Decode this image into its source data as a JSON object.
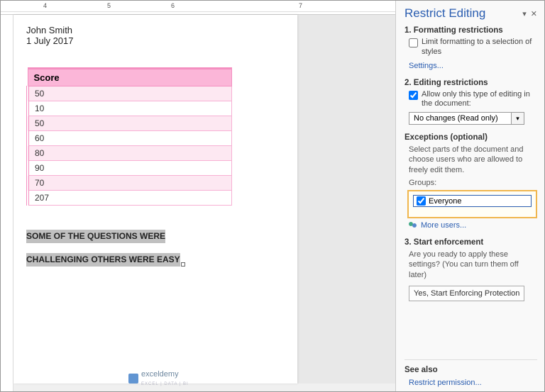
{
  "ruler": {
    "marks": [
      "4",
      "5",
      "6",
      "7"
    ]
  },
  "document": {
    "author": "John Smith",
    "date": "1 July 2017",
    "selected_line1": "SOME OF THE QUESTIONS WERE",
    "selected_line2": "CHALLENGING OTHERS WERE EASY"
  },
  "chart_data": {
    "type": "table",
    "title": "Score",
    "columns": [
      "Score"
    ],
    "values": [
      50,
      10,
      50,
      60,
      80,
      90,
      70,
      207
    ]
  },
  "sidebar": {
    "title": "Restrict Editing",
    "section1": {
      "heading": "1. Formatting restrictions",
      "checkbox_label": "Limit formatting to a selection of styles",
      "checked": false,
      "link": "Settings..."
    },
    "section2": {
      "heading": "2. Editing restrictions",
      "checkbox_label": "Allow only this type of editing in the document:",
      "checked": true,
      "select_value": "No changes (Read only)"
    },
    "exceptions": {
      "heading": "Exceptions (optional)",
      "desc": "Select parts of the document and choose users who are allowed to freely edit them.",
      "groups_label": "Groups:",
      "group_item": "Everyone",
      "group_checked": true,
      "more_users": "More users..."
    },
    "section3": {
      "heading": "3. Start enforcement",
      "desc": "Are you ready to apply these settings? (You can turn them off later)",
      "button": "Yes, Start Enforcing Protection"
    },
    "see_also": {
      "heading": "See also",
      "link": "Restrict permission..."
    }
  },
  "watermark": {
    "text": "exceldemy",
    "sub": "EXCEL | DATA | BI"
  }
}
